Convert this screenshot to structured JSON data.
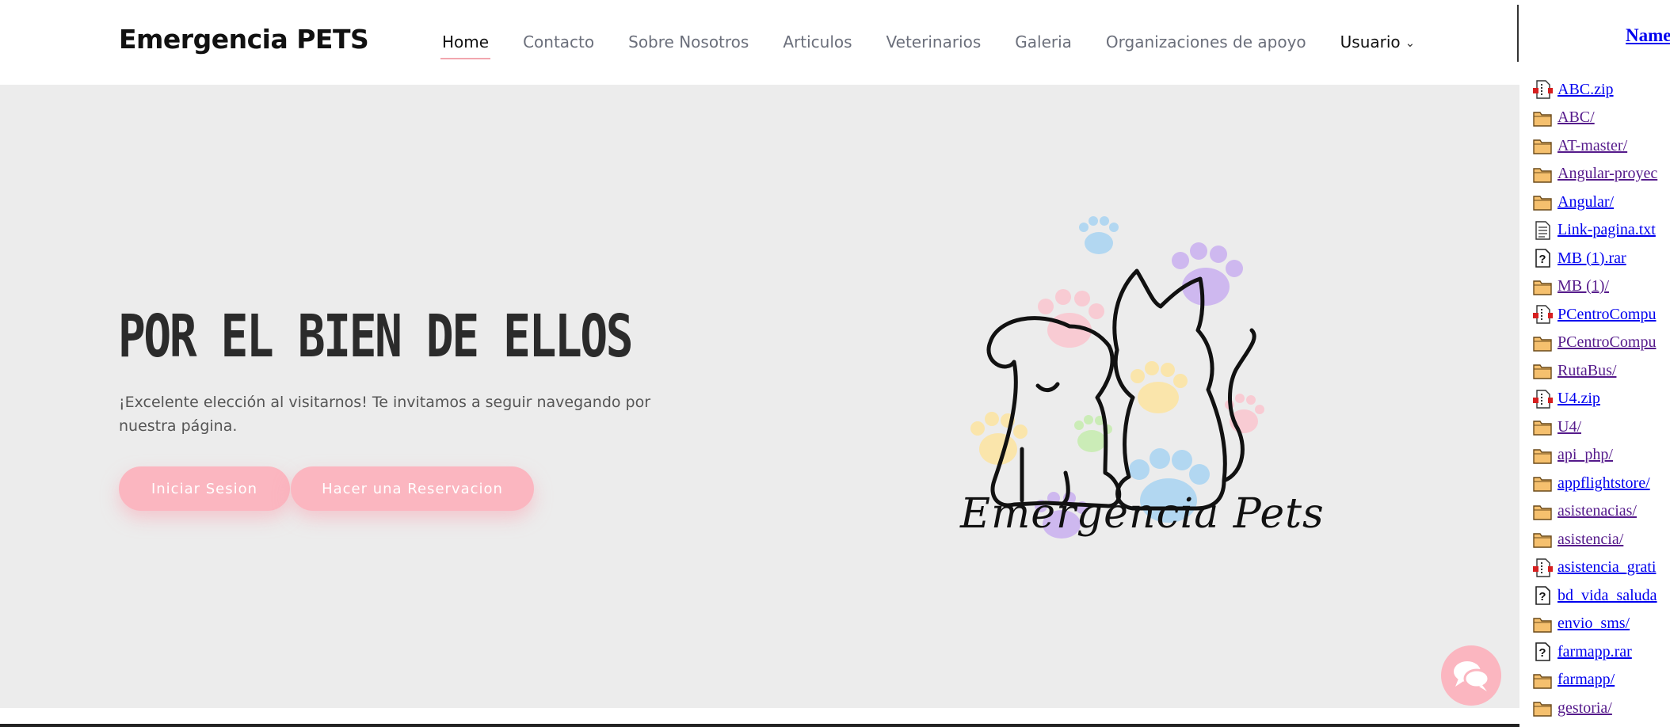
{
  "site": {
    "brand": "Emergencia PETS",
    "nav": [
      {
        "label": "Home",
        "active": true
      },
      {
        "label": "Contacto"
      },
      {
        "label": "Sobre Nosotros"
      },
      {
        "label": "Articulos"
      },
      {
        "label": "Veterinarios"
      },
      {
        "label": "Galeria"
      },
      {
        "label": "Organizaciones de apoyo"
      },
      {
        "label": "Usuario",
        "has_dropdown": true
      }
    ],
    "hero": {
      "title": "POR EL BIEN DE ELLOS",
      "text": "¡Excelente elección al visitarnos! Te invitamos a seguir navegando por nuestra página.",
      "btn_login": "Iniciar Sesion",
      "btn_reserve": "Hacer una Reservacion",
      "logo_text": "Emergencia Pets"
    },
    "colors": {
      "accent_pink": "#fbb6c0",
      "hero_bg": "#ececec",
      "nav_text": "#6b6f7b"
    },
    "chat_icon": "chat-bubbles-icon"
  },
  "listing": {
    "column_header": "Name",
    "items": [
      {
        "name": "ABC.zip",
        "icon": "compressed",
        "visited": false
      },
      {
        "name": "ABC/",
        "icon": "folder",
        "visited": true
      },
      {
        "name": "AT-master/",
        "icon": "folder",
        "visited": true
      },
      {
        "name": "Angular-proyec",
        "icon": "folder",
        "visited": true
      },
      {
        "name": "Angular/",
        "icon": "folder",
        "visited": false
      },
      {
        "name": "Link-pagina.txt",
        "icon": "text",
        "visited": false
      },
      {
        "name": "MB (1).rar",
        "icon": "unknown",
        "visited": false
      },
      {
        "name": "MB (1)/",
        "icon": "folder",
        "visited": true
      },
      {
        "name": "PCentroCompu",
        "icon": "compressed",
        "visited": false
      },
      {
        "name": "PCentroCompu",
        "icon": "folder",
        "visited": true
      },
      {
        "name": "RutaBus/",
        "icon": "folder",
        "visited": true
      },
      {
        "name": "U4.zip",
        "icon": "compressed",
        "visited": false
      },
      {
        "name": "U4/",
        "icon": "folder",
        "visited": true
      },
      {
        "name": "api_php/",
        "icon": "folder",
        "visited": true
      },
      {
        "name": "appflightstore/",
        "icon": "folder",
        "visited": false
      },
      {
        "name": "asistenacias/",
        "icon": "folder",
        "visited": true
      },
      {
        "name": "asistencia/",
        "icon": "folder",
        "visited": true
      },
      {
        "name": "asistencia_grati",
        "icon": "compressed",
        "visited": false
      },
      {
        "name": "bd_vida_saluda",
        "icon": "unknown",
        "visited": false
      },
      {
        "name": "envio_sms/",
        "icon": "folder",
        "visited": false
      },
      {
        "name": "farmapp.rar",
        "icon": "unknown",
        "visited": false
      },
      {
        "name": "farmapp/",
        "icon": "folder",
        "visited": false
      },
      {
        "name": "gestoria/",
        "icon": "folder",
        "visited": true
      }
    ]
  }
}
